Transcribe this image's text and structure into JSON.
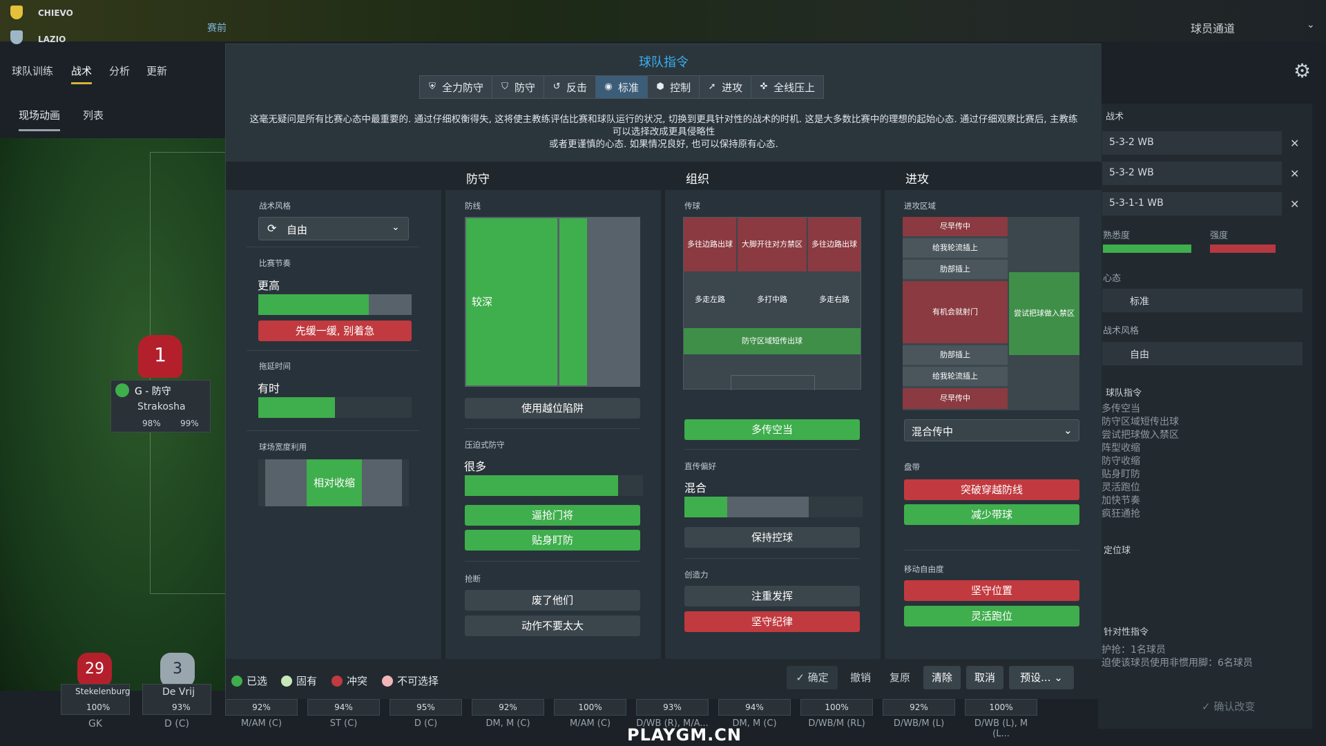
{
  "top": {
    "home_club": "CHIEVO",
    "away_club": "LAZIO",
    "prematch": "赛前",
    "player_channel": "球员通道",
    "tabs": [
      "球队训练",
      "战术",
      "分析",
      "更新"
    ],
    "subtabs": [
      "现场动画",
      "列表"
    ]
  },
  "goalkeeper": {
    "number": "1",
    "role": "G - 防守",
    "name": "Strakosha",
    "stat1": "98%",
    "stat2": "99%"
  },
  "modal": {
    "title": "球队指令",
    "mentalities": [
      {
        "label": "全力防守",
        "icon": "shield-heart-icon"
      },
      {
        "label": "防守",
        "icon": "shield-icon"
      },
      {
        "label": "反击",
        "icon": "counter-icon"
      },
      {
        "label": "标准",
        "icon": "target-icon"
      },
      {
        "label": "控制",
        "icon": "control-shield-icon"
      },
      {
        "label": "进攻",
        "icon": "attack-icon"
      },
      {
        "label": "全线压上",
        "icon": "all-out-icon"
      }
    ],
    "description_1": "这毫无疑问是所有比赛心态中最重要的. 通过仔细权衡得失, 这将使主教练评估比赛和球队运行的状况, 切换到更具针对性的战术的时机. 这是大多数比赛中的理想的起始心态. 通过仔细观察比赛后, 主教练可以选择改成更具侵略性",
    "description_2": "或者更谨慎的心态. 如果情况良好, 也可以保持原有心态."
  },
  "general": {
    "style_label": "战术风格",
    "style_value": "自由",
    "tempo_label": "比赛节奏",
    "tempo_value": "更高",
    "tempo_level": 0.72,
    "tempo_button": "先缓一缓, 别着急",
    "timewasting_label": "拖延时间",
    "timewasting_value": "有时",
    "timewasting_level": 0.5,
    "width_label": "球场宽度利用",
    "width_value": "相对收缩"
  },
  "defense": {
    "header": "防守",
    "line_label": "防线",
    "line_value": "较深",
    "offside_button": "使用越位陷阱",
    "press_label": "压迫式防守",
    "press_value": "很多",
    "press_level": 0.86,
    "press_buttons": [
      "逼抢门将",
      "贴身盯防"
    ],
    "tackle_label": "抢断",
    "tackle_buttons": [
      "废了他们",
      "动作不要太大"
    ]
  },
  "organize": {
    "header": "组织",
    "pass_label": "传球",
    "zones_top": [
      "多往边路出球",
      "大脚开往对方禁区",
      "多往边路出球"
    ],
    "zones_mid": [
      "多走左路",
      "多打中路",
      "多走右路"
    ],
    "zone_bottom": "防守区域短传出球",
    "pass_button": "多传空当",
    "directness_label": "直传偏好",
    "directness_value": "混合",
    "directness_level": 0.5,
    "directness_button": "保持控球",
    "creativity_label": "创造力",
    "creativity_buttons": [
      "注重发挥",
      "坚守纪律"
    ]
  },
  "attack": {
    "header": "进攻",
    "zone_label": "进攻区域",
    "zones_left": [
      "尽早传中",
      "给我轮流插上",
      "肋部插上",
      "有机会就射门",
      "肋部插上",
      "给我轮流插上",
      "尽早传中"
    ],
    "zone_box": "尝试把球做入禁区",
    "cross_select": "混合传中",
    "dribble_label": "盘带",
    "dribble_buttons": [
      "突破穿越防线",
      "减少带球"
    ],
    "freedom_label": "移动自由度",
    "freedom_buttons": [
      "坚守位置",
      "灵活跑位"
    ]
  },
  "legend": [
    "已选",
    "固有",
    "冲突",
    "不可选择"
  ],
  "footer_buttons": {
    "confirm": "确定",
    "undo": "撤销",
    "redo": "复原",
    "clear": "清除",
    "cancel": "取消",
    "preset": "预设..."
  },
  "right": {
    "tactics_label": "战术",
    "formations": [
      "5-3-2 WB",
      "5-3-2 WB",
      "5-3-1-1 WB"
    ],
    "familiarity": "熟悉度",
    "intensity": "强度",
    "mentality_label": "心态",
    "mentality_value": "标准",
    "style_label": "战术风格",
    "style_value": "自由",
    "team_instr_label": "球队指令",
    "team_instr_list": [
      "多传空当",
      "防守区域短传出球",
      "尝试把球做入禁区",
      "阵型收缩",
      "防守收缩",
      "贴身盯防",
      "灵活跑位",
      "加快节奏",
      "疯狂通抢"
    ],
    "setpiece_label": "定位球",
    "opp_instr_label": "针对性指令",
    "opp_instr_1": "护抢：1名球员",
    "opp_instr_2": "迫使该球员使用非惯用脚：6名球员",
    "confirm_change": "确认改变"
  },
  "bottom_players": [
    {
      "number": "29",
      "name": "Stekelenburg",
      "stat": "100%",
      "pos": "GK"
    },
    {
      "number": "3",
      "name": "De Vrij",
      "stat": "93%",
      "pos": "D (C)"
    }
  ],
  "bottom_stats": [
    {
      "stat": "92%",
      "pos": "M/AM (C)"
    },
    {
      "stat": "94%",
      "pos": "ST (C)"
    },
    {
      "stat": "95%",
      "pos": "D (C)"
    },
    {
      "stat": "92%",
      "pos": "DM, M (C)"
    },
    {
      "stat": "100%",
      "pos": "M/AM (C)"
    },
    {
      "stat": "93%",
      "pos": "D/WB (R), M/A..."
    },
    {
      "stat": "94%",
      "pos": "DM, M (C)"
    },
    {
      "stat": "100%",
      "pos": "D/WB/M (RL)"
    },
    {
      "stat": "92%",
      "pos": "D/WB/M (L)"
    },
    {
      "stat": "100%",
      "pos": "D/WB (L), M (L..."
    }
  ],
  "watermark": "PLAYGM.CN"
}
